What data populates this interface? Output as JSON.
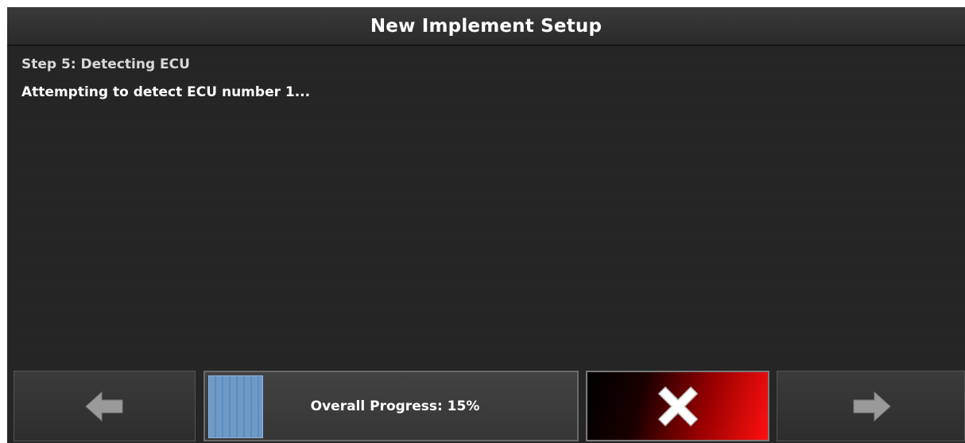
{
  "window": {
    "title": "New Implement Setup"
  },
  "content": {
    "step_title": "Step 5: Detecting ECU",
    "status_message": "Attempting to detect ECU number 1..."
  },
  "footer": {
    "back_icon": "arrow-left-icon",
    "cancel_icon": "close-x-icon",
    "next_icon": "arrow-right-icon",
    "progress": {
      "label": "Overall Progress: 15%",
      "value_percent": 15,
      "fill_color": "#6e9ac8"
    }
  },
  "colors": {
    "background": "#242424",
    "cancel_red": "#ff1010",
    "arrow_gray": "#9a9a9a"
  }
}
